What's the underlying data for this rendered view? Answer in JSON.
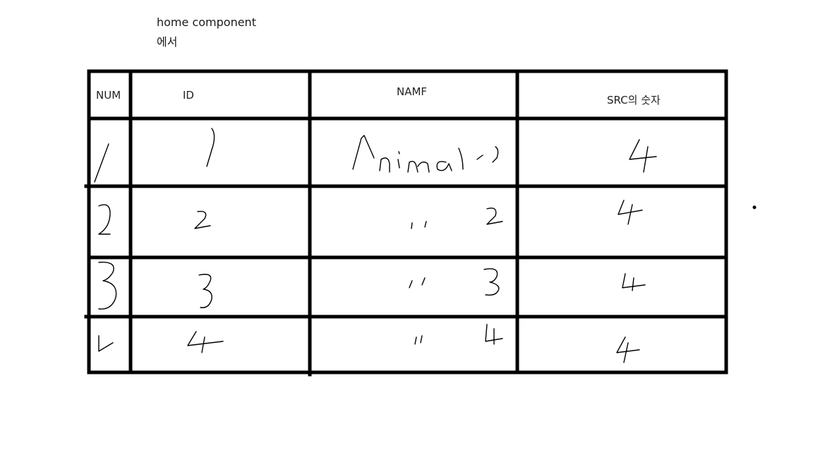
{
  "caption": {
    "line1": "home component",
    "line2": "에서"
  },
  "table": {
    "headers": {
      "num": "NUM",
      "id": "ID",
      "name": "NAMF",
      "src": "SRC의 숫자"
    },
    "rows": [
      {
        "num": "1",
        "id": "1",
        "name": "Animal 1",
        "src": "4"
      },
      {
        "num": "2",
        "id": "2",
        "name": "\" 2",
        "src": "4"
      },
      {
        "num": "3",
        "id": "3",
        "name": "\" 3",
        "src": "4"
      },
      {
        "num": "4",
        "id": "4",
        "name": "\" 4",
        "src": "4"
      }
    ]
  }
}
